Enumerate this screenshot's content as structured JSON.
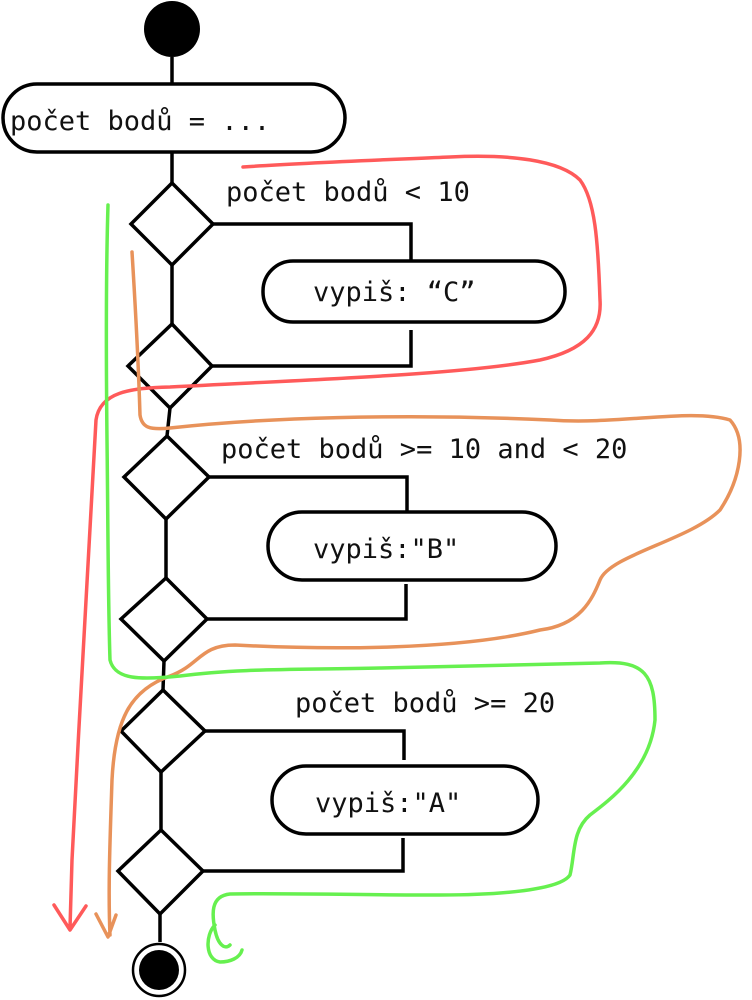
{
  "diagram": {
    "type": "activity-flowchart",
    "start_node": "initial",
    "end_node": "final",
    "init_action": "počet bodů = ...",
    "branches": [
      {
        "condition": "počet bodů < 10",
        "action": "vypiš: “C”",
        "annotation_color": "#ff5a5a"
      },
      {
        "condition": "počet bodů >= 10 and < 20",
        "action": "vypiš:\"B\"",
        "annotation_color": "#e8925a"
      },
      {
        "condition": "počet bodů >= 20",
        "action": "vypiš:\"A\"",
        "annotation_color": "#66f04f"
      }
    ]
  }
}
